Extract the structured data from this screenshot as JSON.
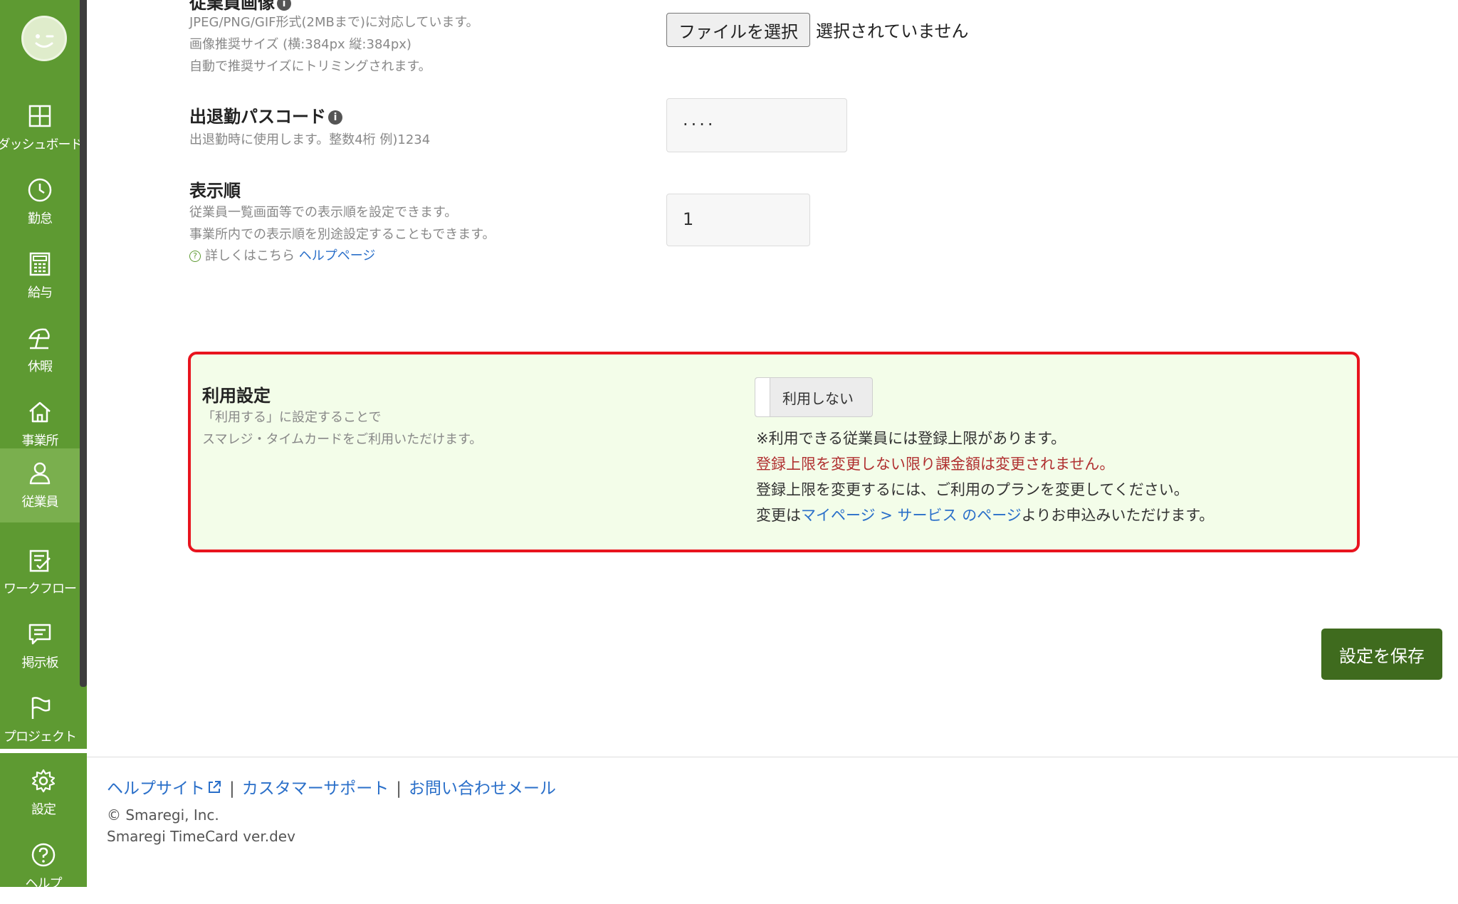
{
  "sidebar": {
    "items": [
      {
        "label": "ダッシュボード",
        "icon": "dashboard-icon"
      },
      {
        "label": "勤怠",
        "icon": "clock-icon"
      },
      {
        "label": "給与",
        "icon": "calculator-icon"
      },
      {
        "label": "休暇",
        "icon": "beach-umbrella-icon"
      },
      {
        "label": "事業所",
        "icon": "home-icon"
      },
      {
        "label": "従業員",
        "icon": "person-icon",
        "active": true
      },
      {
        "label": "ワークフロー",
        "icon": "clipboard-check-icon"
      },
      {
        "label": "掲示板",
        "icon": "message-icon"
      },
      {
        "label": "プロジェクト",
        "icon": "flag-icon"
      },
      {
        "label": "設定",
        "icon": "gear-icon"
      },
      {
        "label": "ヘルプ",
        "icon": "help-icon"
      }
    ]
  },
  "image_field": {
    "title": "従業員画像",
    "desc1": "JPEG/PNG/GIF形式(2MBまで)に対応しています。",
    "desc2": "画像推奨サイズ (横:384px 縦:384px)",
    "desc3": "自動で推奨サイズにトリミングされます。",
    "file_button": "ファイルを選択",
    "file_status": "選択されていません"
  },
  "passcode_field": {
    "title": "出退勤パスコード",
    "desc": "出退勤時に使用します。整数4桁 例)1234",
    "value": "····"
  },
  "order_field": {
    "title": "表示順",
    "desc1": "従業員一覧画面等での表示順を設定できます。",
    "desc2": "事業所内での表示順を別途設定することもできます。",
    "help_prefix": "詳しくはこちら",
    "help_link": "ヘルプページ",
    "value": "1"
  },
  "usage": {
    "title": "利用設定",
    "desc1": "「利用する」に設定することで",
    "desc2": "スマレジ・タイムカードをご利用いただけます。",
    "toggle_label": "利用しない",
    "note1": "※利用できる従業員には登録上限があります。",
    "note2": "登録上限を変更しない限り課金額は変更されません。",
    "note3": "登録上限を変更するには、ご利用のプランを変更してください。",
    "note4_prefix": "変更は",
    "note4_link": "マイページ > サービス のページ",
    "note4_suffix": "よりお申込みいただけます。"
  },
  "save_button": "設定を保存",
  "footer": {
    "help_site": "ヘルプサイト",
    "support": "カスタマーサポート",
    "contact": "お問い合わせメール",
    "separator": "|",
    "copyright": "© Smaregi, Inc.",
    "version": "Smaregi TimeCard ver.dev"
  },
  "colors": {
    "sidebar": "#5e9a32",
    "highlight_border": "#e8141e",
    "highlight_bg": "#f3fde9",
    "save_button": "#3f6b1e",
    "link": "#2a6fc9",
    "warning_text": "#b03030"
  }
}
